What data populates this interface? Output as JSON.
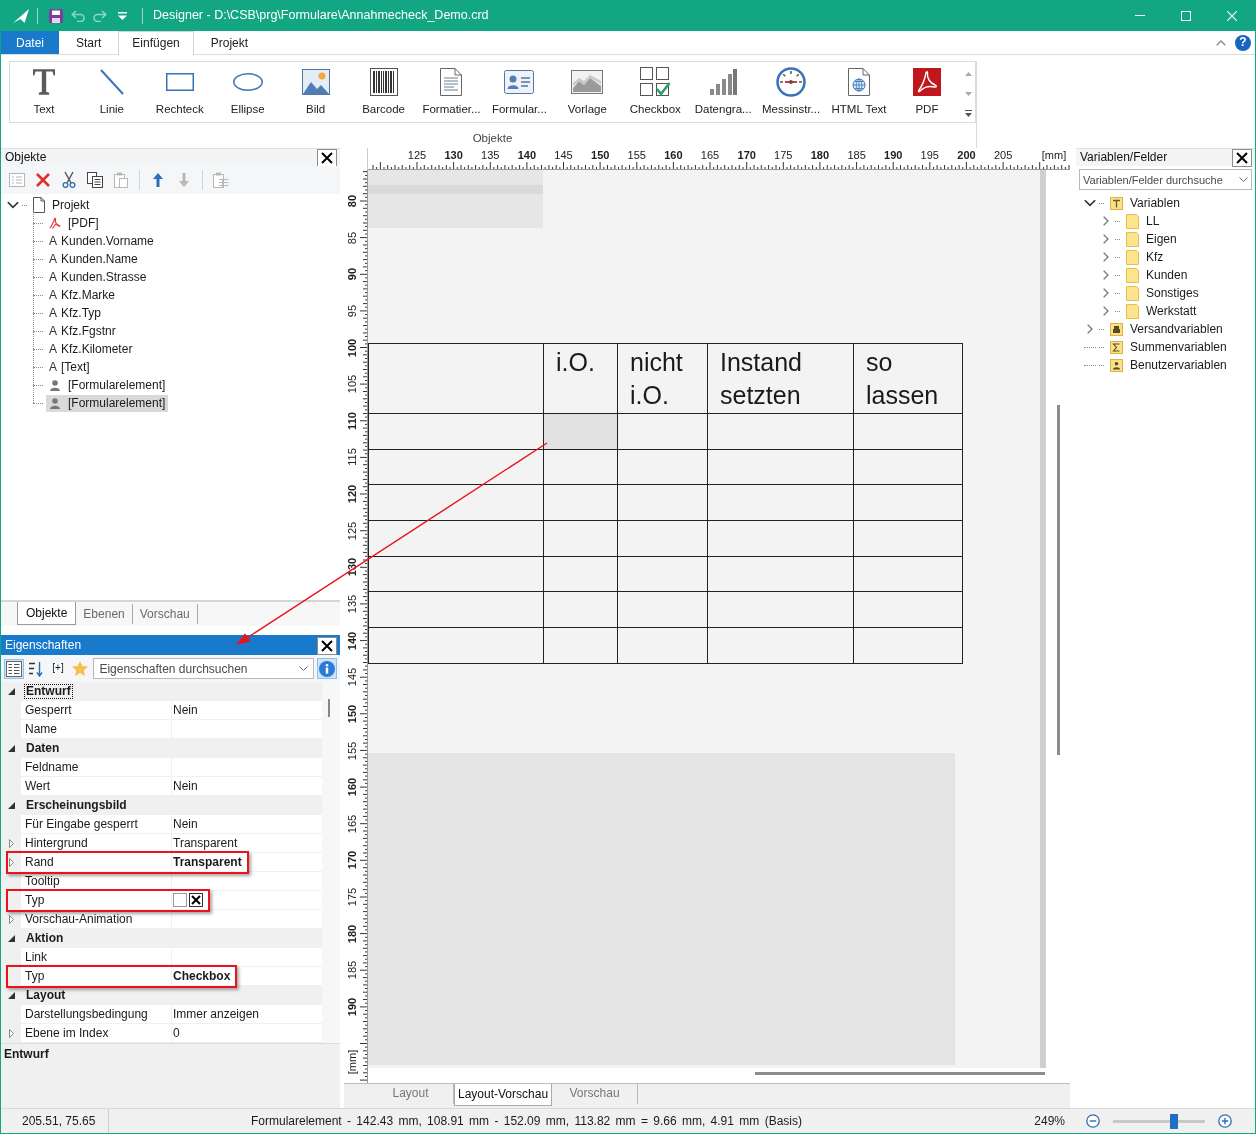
{
  "window": {
    "title": "Designer - D:\\CSB\\prg\\Formulare\\Annahmecheck_Demo.crd"
  },
  "quick_access": [
    {
      "kind": "save",
      "disabled": false
    },
    {
      "kind": "undo",
      "disabled": true
    },
    {
      "kind": "redo",
      "disabled": true
    },
    {
      "kind": "customize",
      "disabled": false
    }
  ],
  "ribbon": {
    "tabs": [
      {
        "label": "Datei",
        "kind": "file",
        "selected": false
      },
      {
        "label": "Start",
        "kind": "tab",
        "selected": false
      },
      {
        "label": "Einfügen",
        "kind": "tab",
        "selected": true
      },
      {
        "label": "Projekt",
        "kind": "tab",
        "selected": false
      }
    ],
    "help": "?",
    "group": {
      "label": "Objekte",
      "items": [
        {
          "label": "Text",
          "kind": "text"
        },
        {
          "label": "Linie",
          "kind": "line"
        },
        {
          "label": "Rechteck",
          "kind": "rectangle"
        },
        {
          "label": "Ellipse",
          "kind": "ellipse"
        },
        {
          "label": "Bild",
          "kind": "picture"
        },
        {
          "label": "Barcode",
          "kind": "barcode"
        },
        {
          "label": "Formatier...",
          "kind": "formatted"
        },
        {
          "label": "Formular...",
          "kind": "form"
        },
        {
          "label": "Vorlage",
          "kind": "template"
        },
        {
          "label": "Checkbox",
          "kind": "checkbox"
        },
        {
          "label": "Datengra...",
          "kind": "chart"
        },
        {
          "label": "Messinstr...",
          "kind": "gauge"
        },
        {
          "label": "HTML Text",
          "kind": "html"
        },
        {
          "label": "PDF",
          "kind": "pdf"
        }
      ]
    }
  },
  "objects_panel": {
    "title": "Objekte",
    "active": false,
    "toolbar": [
      [
        {
          "kind": "properties",
          "disabled": true
        },
        {
          "kind": "delete",
          "disabled": false
        },
        {
          "kind": "cut",
          "disabled": false
        },
        {
          "kind": "copy",
          "disabled": false
        },
        {
          "kind": "paste",
          "disabled": true
        }
      ],
      [
        {
          "kind": "up",
          "disabled": false
        },
        {
          "kind": "down",
          "disabled": true
        }
      ],
      [
        {
          "kind": "sheet",
          "disabled": true
        }
      ]
    ],
    "tree": {
      "label": "Projekt",
      "kind": "page",
      "expanded": true,
      "selected": false,
      "children": [
        {
          "label": "[PDF]",
          "kind": "pdf",
          "selected": false
        },
        {
          "label": "Kunden.Vorname",
          "kind": "text",
          "glyph": "A",
          "selected": false
        },
        {
          "label": "Kunden.Name",
          "kind": "text",
          "glyph": "A",
          "selected": false
        },
        {
          "label": "Kunden.Strasse",
          "kind": "text",
          "glyph": "A",
          "selected": false
        },
        {
          "label": "Kfz.Marke",
          "kind": "text",
          "glyph": "A",
          "selected": false
        },
        {
          "label": "Kfz.Typ",
          "kind": "text",
          "glyph": "A",
          "selected": false
        },
        {
          "label": "Kfz.Fgstnr",
          "kind": "text",
          "glyph": "A",
          "selected": false
        },
        {
          "label": "Kfz.Kilometer",
          "kind": "text",
          "glyph": "A",
          "selected": false
        },
        {
          "label": "[Text]",
          "kind": "text",
          "glyph": "A",
          "selected": false
        },
        {
          "label": "[Formularelement]",
          "kind": "form",
          "selected": false
        },
        {
          "label": "[Formularelement]",
          "kind": "form",
          "selected": true
        }
      ]
    },
    "tabs": [
      {
        "label": "Objekte",
        "selected": true
      },
      {
        "label": "Ebenen",
        "selected": false
      },
      {
        "label": "Vorschau",
        "selected": false
      }
    ]
  },
  "properties_panel": {
    "title": "Eigenschaften",
    "active": true,
    "toolbar": [
      {
        "kind": "categorized",
        "pressed": true
      },
      {
        "kind": "sort",
        "pressed": false
      },
      {
        "kind": "expand_all",
        "label": "[+]",
        "pressed": false
      },
      {
        "kind": "favorites",
        "pressed": false
      }
    ],
    "search": {
      "placeholder": "Eigenschaften durchsuchen"
    },
    "groups": [
      {
        "name": "Entwurf",
        "expanded": true,
        "selected": true,
        "items": [
          {
            "label": "Gesperrt",
            "kind": "text",
            "value": "Nein",
            "expandable": false,
            "modified": false,
            "highlighted": false
          },
          {
            "label": "Name",
            "kind": "text",
            "expandable": false,
            "highlighted": false
          }
        ]
      },
      {
        "name": "Daten",
        "expanded": true,
        "selected": false,
        "items": [
          {
            "label": "Feldname",
            "kind": "text",
            "expandable": false,
            "highlighted": false
          },
          {
            "label": "Wert",
            "kind": "text",
            "value": "Nein",
            "expandable": false,
            "modified": false,
            "highlighted": false
          }
        ]
      },
      {
        "name": "Erscheinungsbild",
        "expanded": true,
        "selected": false,
        "items": [
          {
            "label": "Für Eingabe gesperrt",
            "kind": "text",
            "value": "Nein",
            "expandable": false,
            "modified": false,
            "highlighted": false
          },
          {
            "label": "Hintergrund",
            "kind": "text",
            "value": "Transparent",
            "expandable": true,
            "modified": false,
            "highlighted": false
          },
          {
            "label": "Rand",
            "kind": "text",
            "value": "Transparent",
            "expandable": true,
            "modified": true,
            "highlighted": true
          },
          {
            "label": "Tooltip",
            "kind": "text",
            "expandable": false,
            "highlighted": false
          },
          {
            "label": "Typ",
            "kind": "checkbox_preview",
            "preview": [
              {
                "checked": false
              },
              {
                "checked": true
              }
            ],
            "expandable": false,
            "highlighted": true
          },
          {
            "label": "Vorschau-Animation",
            "kind": "text",
            "expandable": true,
            "highlighted": false
          }
        ]
      },
      {
        "name": "Aktion",
        "expanded": true,
        "selected": false,
        "items": [
          {
            "label": "Link",
            "kind": "text",
            "expandable": false,
            "highlighted": false
          },
          {
            "label": "Typ",
            "kind": "text",
            "value": "Checkbox",
            "expandable": false,
            "modified": true,
            "highlighted": true
          }
        ]
      },
      {
        "name": "Layout",
        "expanded": true,
        "selected": false,
        "items": [
          {
            "label": "Darstellungsbedingung",
            "kind": "text",
            "value": "Immer anzeigen",
            "expandable": false,
            "modified": false,
            "highlighted": false
          },
          {
            "label": "Ebene im Index",
            "kind": "text",
            "value": "0",
            "expandable": true,
            "modified": false,
            "highlighted": false
          }
        ]
      }
    ],
    "description": "Entwurf"
  },
  "canvas": {
    "ruler": {
      "horizontal": [
        {
          "label": "125",
          "major": false
        },
        {
          "label": "130",
          "major": true
        },
        {
          "label": "135",
          "major": false
        },
        {
          "label": "140",
          "major": true
        },
        {
          "label": "145",
          "major": false
        },
        {
          "label": "150",
          "major": true
        },
        {
          "label": "155",
          "major": false
        },
        {
          "label": "160",
          "major": true
        },
        {
          "label": "165",
          "major": false
        },
        {
          "label": "170",
          "major": true
        },
        {
          "label": "175",
          "major": false
        },
        {
          "label": "180",
          "major": true
        },
        {
          "label": "185",
          "major": false
        },
        {
          "label": "190",
          "major": true
        },
        {
          "label": "195",
          "major": false
        },
        {
          "label": "200",
          "major": true
        },
        {
          "label": "205",
          "major": false
        }
      ],
      "horizontal_unit": "[mm]",
      "vertical": [
        {
          "label": "80",
          "major": true
        },
        {
          "label": "85",
          "major": false
        },
        {
          "label": "90",
          "major": true
        },
        {
          "label": "95",
          "major": false
        },
        {
          "label": "100",
          "major": true
        },
        {
          "label": "105",
          "major": false
        },
        {
          "label": "110",
          "major": true
        },
        {
          "label": "115",
          "major": false
        },
        {
          "label": "120",
          "major": true
        },
        {
          "label": "125",
          "major": false
        },
        {
          "label": "130",
          "major": true
        },
        {
          "label": "135",
          "major": false
        },
        {
          "label": "140",
          "major": true
        },
        {
          "label": "145",
          "major": false
        },
        {
          "label": "150",
          "major": true
        },
        {
          "label": "155",
          "major": false
        },
        {
          "label": "160",
          "major": true
        },
        {
          "label": "165",
          "major": false
        },
        {
          "label": "170",
          "major": true
        },
        {
          "label": "175",
          "major": false
        },
        {
          "label": "180",
          "major": true
        },
        {
          "label": "185",
          "major": false
        },
        {
          "label": "190",
          "major": true
        }
      ],
      "vertical_unit": "[mm]"
    },
    "table": {
      "header": [
        "i.O.",
        "nicht i.O.",
        "Instand setzten",
        "so lassen"
      ],
      "rows": [
        {
          "cells": [
            {
              "selected": false
            },
            {
              "selected": true
            },
            {
              "selected": false
            },
            {
              "selected": false
            },
            {
              "selected": false
            }
          ]
        },
        {
          "cells": [
            {
              "selected": false
            },
            {
              "selected": false
            },
            {
              "selected": false
            },
            {
              "selected": false
            },
            {
              "selected": false
            }
          ]
        },
        {
          "cells": [
            {
              "selected": false
            },
            {
              "selected": false
            },
            {
              "selected": false
            },
            {
              "selected": false
            },
            {
              "selected": false
            }
          ]
        },
        {
          "cells": [
            {
              "selected": false
            },
            {
              "selected": false
            },
            {
              "selected": false
            },
            {
              "selected": false
            },
            {
              "selected": false
            }
          ]
        },
        {
          "cells": [
            {
              "selected": false
            },
            {
              "selected": false
            },
            {
              "selected": false
            },
            {
              "selected": false
            },
            {
              "selected": false
            }
          ]
        },
        {
          "cells": [
            {
              "selected": false
            },
            {
              "selected": false
            },
            {
              "selected": false
            },
            {
              "selected": false
            },
            {
              "selected": false
            }
          ]
        },
        {
          "cells": [
            {
              "selected": false
            },
            {
              "selected": false
            },
            {
              "selected": false
            },
            {
              "selected": false
            },
            {
              "selected": false
            }
          ]
        }
      ]
    },
    "tabs": [
      {
        "label": "Layout",
        "selected": false
      },
      {
        "label": "Layout-Vorschau",
        "selected": true
      },
      {
        "label": "Vorschau",
        "selected": false
      }
    ]
  },
  "variables_panel": {
    "title": "Variablen/Felder",
    "search": {
      "placeholder": "Variablen/Felder durchsuche"
    },
    "tree": [
      {
        "label": "Variablen",
        "kind": "variables",
        "expandable": true,
        "expanded": true,
        "children": [
          {
            "label": "LL",
            "kind": "folder",
            "expandable": true,
            "expanded": false
          },
          {
            "label": "Eigen",
            "kind": "folder",
            "expandable": true,
            "expanded": false
          },
          {
            "label": "Kfz",
            "kind": "folder",
            "expandable": true,
            "expanded": false
          },
          {
            "label": "Kunden",
            "kind": "folder",
            "expandable": true,
            "expanded": false
          },
          {
            "label": "Sonstiges",
            "kind": "folder",
            "expandable": true,
            "expanded": false
          },
          {
            "label": "Werkstatt",
            "kind": "folder",
            "expandable": true,
            "expanded": false
          }
        ]
      },
      {
        "label": "Versandvariablen",
        "kind": "shipping",
        "expandable": true,
        "expanded": false
      },
      {
        "label": "Summenvariablen",
        "kind": "sum",
        "expandable": false
      },
      {
        "label": "Benutzervariablen",
        "kind": "user",
        "expandable": false
      }
    ]
  },
  "status_bar": {
    "position": "205.51, 75.65",
    "selection": "Formularelement - 142.43 mm, 108.91 mm - 152.09 mm, 113.82 mm = 9.66 mm, 4.91 mm (Basis)",
    "zoom": "249%",
    "zoom_slider": {
      "level": 0.68
    }
  }
}
